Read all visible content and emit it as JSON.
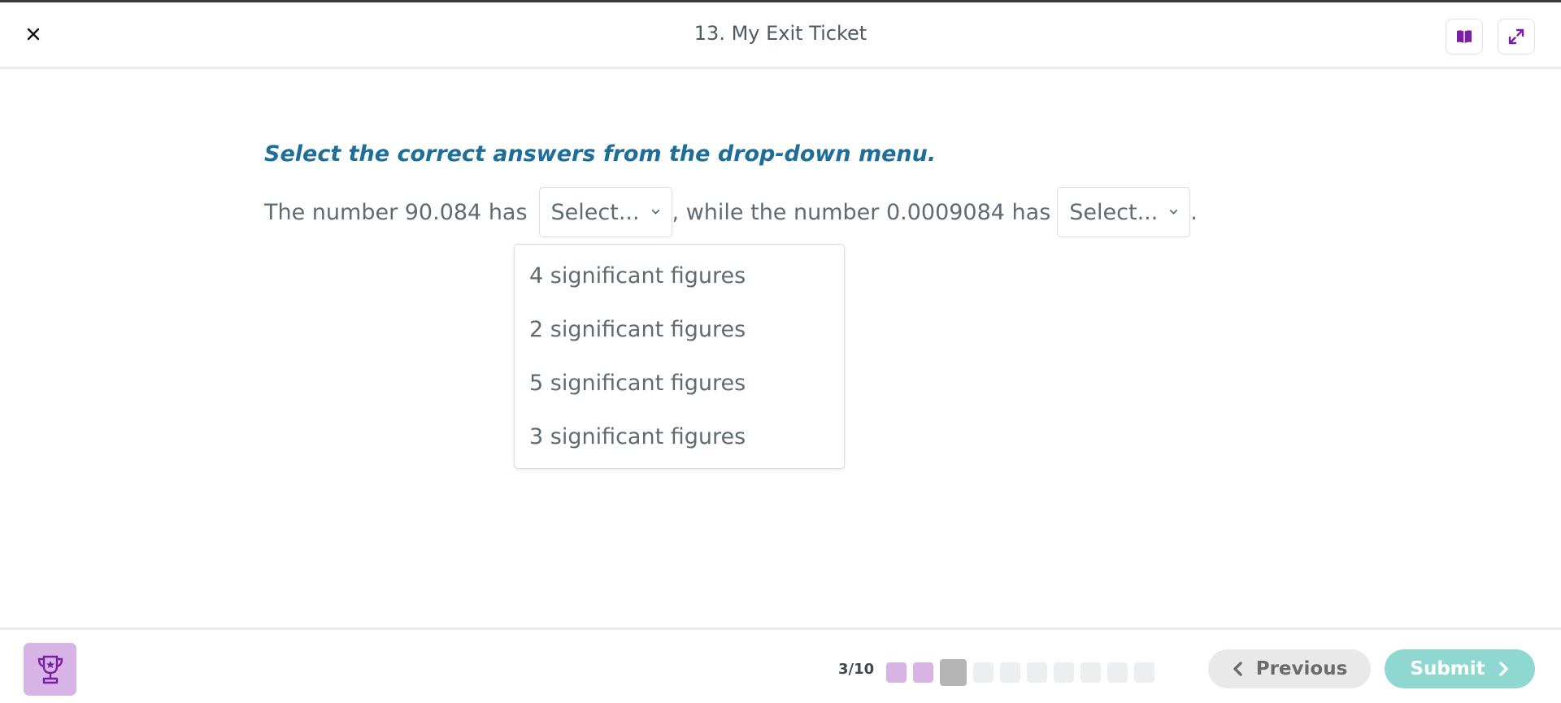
{
  "header": {
    "title": "13. My Exit Ticket",
    "close_icon": "close-icon",
    "book_icon": "book-icon",
    "expand_icon": "expand-icon"
  },
  "main": {
    "instruction": "Select the correct answers from the drop-down menu.",
    "sentence_part1": "The number 90.084 has",
    "sentence_part2": ", while the number 0.0009084 has",
    "sentence_part3": ".",
    "select1_placeholder": "Select...",
    "select2_placeholder": "Select...",
    "dropdown_options": [
      "4 significant figures",
      "2 significant figures",
      "5 significant figures",
      "3 significant figures"
    ]
  },
  "footer": {
    "progress_label": "3/10",
    "progress_current": 3,
    "progress_total": 10,
    "previous_label": "Previous",
    "submit_label": "Submit",
    "trophy_icon": "trophy-icon"
  },
  "colors": {
    "accent_purple": "#7b1fa2",
    "instruction_blue": "#1d6e9a",
    "done_dot": "#d8b4e6",
    "current_dot": "#b5b5b5",
    "submit_bg": "#8fd8d2"
  }
}
